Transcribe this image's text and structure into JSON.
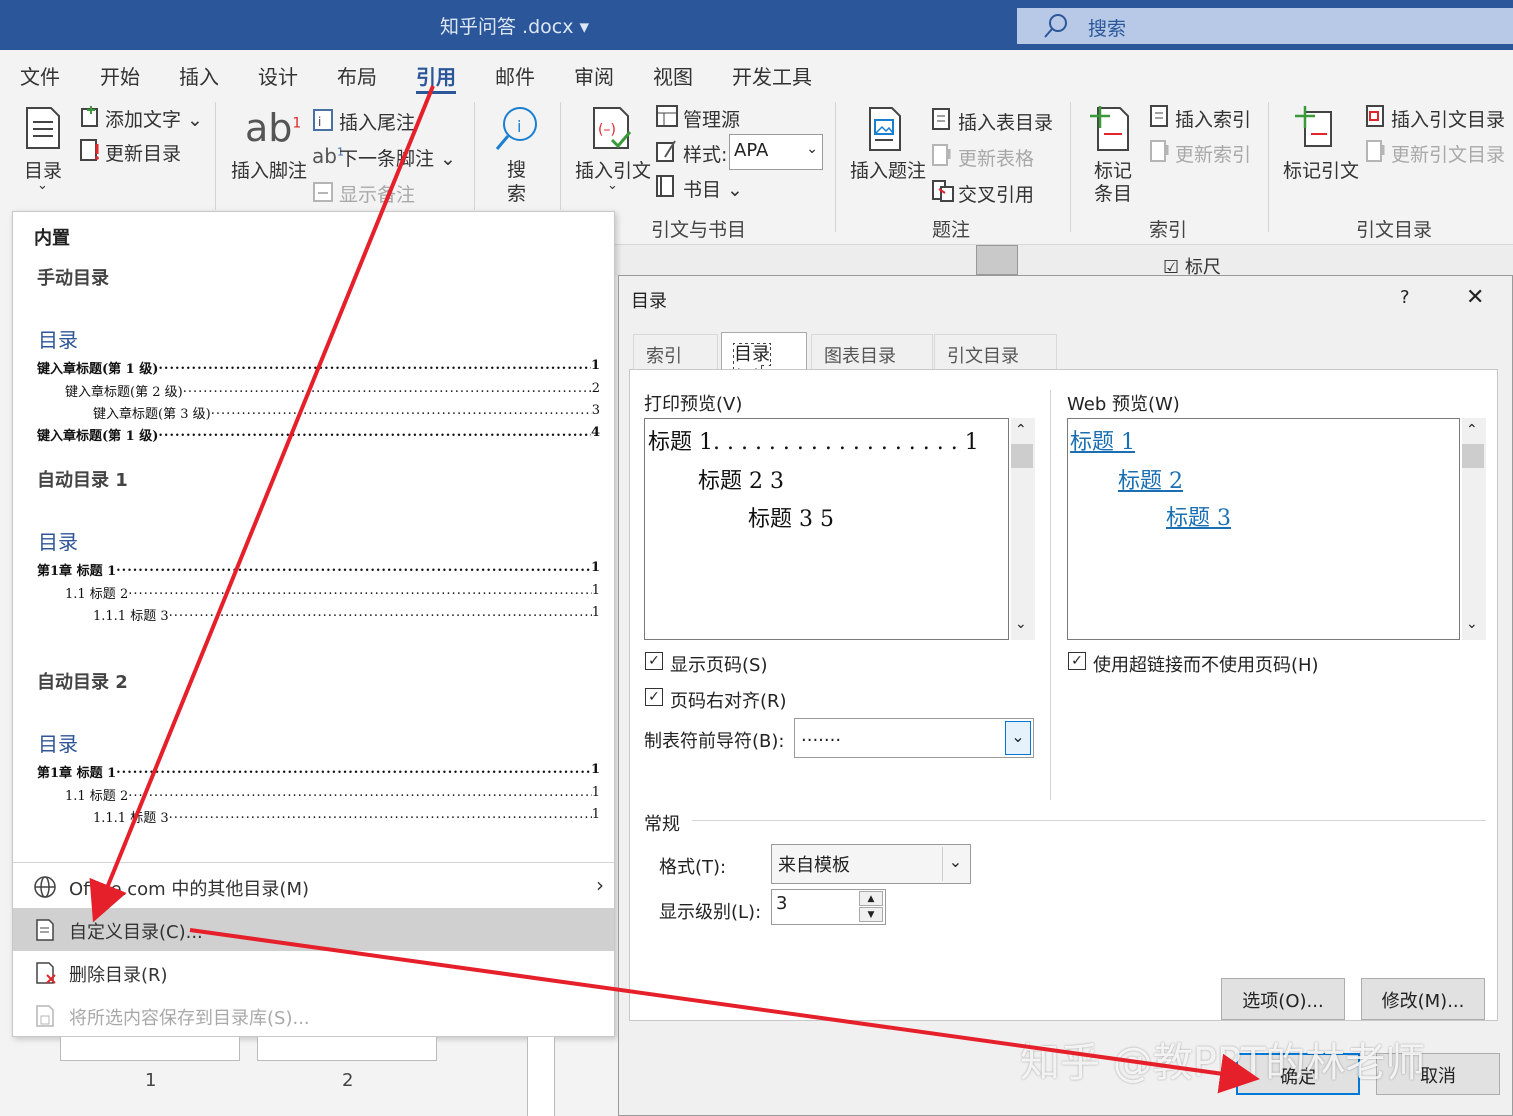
{
  "window": {
    "title": "知乎问答 .docx",
    "search_placeholder": "搜索"
  },
  "menu": {
    "tabs": [
      "文件",
      "开始",
      "插入",
      "设计",
      "布局",
      "引用",
      "邮件",
      "审阅",
      "视图",
      "开发工具"
    ],
    "active": "引用"
  },
  "ribbon": {
    "toc_label": "目录",
    "add_text": "添加文字",
    "update_toc": "更新目录",
    "insert_footnote": "插入脚注",
    "insert_endnote": "插入尾注",
    "next_footnote": "下一条脚注",
    "show_notes": "显示备注",
    "search_line1": "搜",
    "search_line2": "索",
    "insert_citation": "插入引文",
    "manage_sources": "管理源",
    "style_label": "样式:",
    "style_value": "APA",
    "bibliography": "书目",
    "group_citations": "引文与书目",
    "insert_caption": "插入题注",
    "insert_table_of_figures": "插入表目录",
    "update_table": "更新表格",
    "cross_reference": "交叉引用",
    "group_captions": "题注",
    "mark_entry_line1": "标记",
    "mark_entry_line2": "条目",
    "insert_index": "插入索引",
    "update_index": "更新索引",
    "group_index": "索引",
    "mark_citation": "标记引文",
    "insert_table_of_authorities": "插入引文目录",
    "update_table_of_authorities": "更新引文目录",
    "group_authorities": "引文目录",
    "toolbar2_ruler": "标尺"
  },
  "gallery": {
    "builtin": "内置",
    "manual_title": "手动目录",
    "manual_toc_heading": "目录",
    "manual_lines": [
      {
        "text": "键入章标题(第 1 级)",
        "page": "1"
      },
      {
        "text": "键入章标题(第 2 级)",
        "page": "2"
      },
      {
        "text": "键入章标题(第 3 级)",
        "page": "3"
      },
      {
        "text": "键入章标题(第 1 级)",
        "page": "4"
      }
    ],
    "auto1_title": "自动目录 1",
    "auto1_toc_heading": "目录",
    "auto1_lines": [
      {
        "text": "第1章 标题 1",
        "page": "1"
      },
      {
        "text": "1.1 标题 2",
        "page": "1"
      },
      {
        "text": "1.1.1 标题 3",
        "page": "1"
      }
    ],
    "auto2_title": "自动目录 2",
    "auto2_toc_heading": "目录",
    "auto2_lines": [
      {
        "text": "第1章 标题 1",
        "page": "1"
      },
      {
        "text": "1.1 标题 2",
        "page": "1"
      },
      {
        "text": "1.1.1 标题 3",
        "page": "1"
      }
    ],
    "more_office": "Office.com 中的其他目录(M)",
    "custom_toc": "自定义目录(C)...",
    "remove_toc": "删除目录(R)",
    "save_selection": "将所选内容保存到目录库(S)..."
  },
  "dialog": {
    "title": "目录",
    "help": "?",
    "close": "✕",
    "tabs": [
      "索引(X)",
      "目录(C)",
      "图表目录(F)",
      "引文目录(A)"
    ],
    "active_tab": "目录(C)",
    "print_preview_label": "打印预览(V)",
    "print_preview_lines": [
      "标题 1. . . . . . . . . . . . . . . . . . 1",
      "标题 2 3",
      "标题 3 5"
    ],
    "web_preview_label": "Web 预览(W)",
    "web_preview_lines": [
      "标题 1",
      "标题 2",
      "标题 3"
    ],
    "show_page_numbers": "显示页码(S)",
    "right_align": "页码右对齐(R)",
    "use_hyperlinks": "使用超链接而不使用页码(H)",
    "tab_leader_label": "制表符前导符(B):",
    "tab_leader_value": ".......",
    "general_label": "常规",
    "format_label": "格式(T):",
    "format_value": "来自模板",
    "levels_label": "显示级别(L):",
    "levels_value": "3",
    "options_button": "选项(O)...",
    "modify_button": "修改(M)...",
    "ok_button": "确定",
    "cancel_button": "取消"
  },
  "thumbnails": [
    "1",
    "2"
  ],
  "watermark": "知乎 @教PPT的林老师",
  "colors": {
    "title_bar": "#2b579a",
    "arrow": "#e5202a",
    "link": "#1a6fb3"
  }
}
